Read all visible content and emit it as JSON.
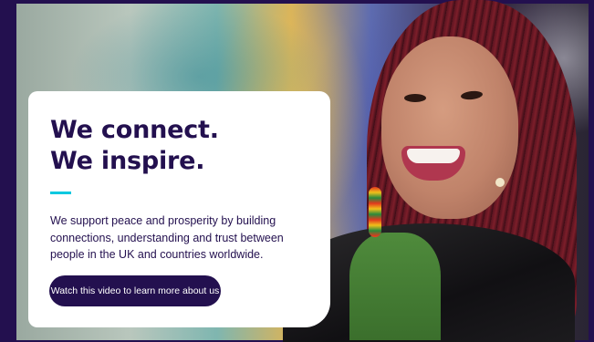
{
  "hero": {
    "headline": "We connect. We inspire.",
    "description": "We support peace and prosperity by building connections, understanding and trust between people in the UK and countries worldwide.",
    "cta_label": "Watch this video to learn more about us"
  },
  "colors": {
    "brand_navy": "#23104f",
    "accent_cyan": "#00c8e0",
    "card_background": "#ffffff"
  }
}
